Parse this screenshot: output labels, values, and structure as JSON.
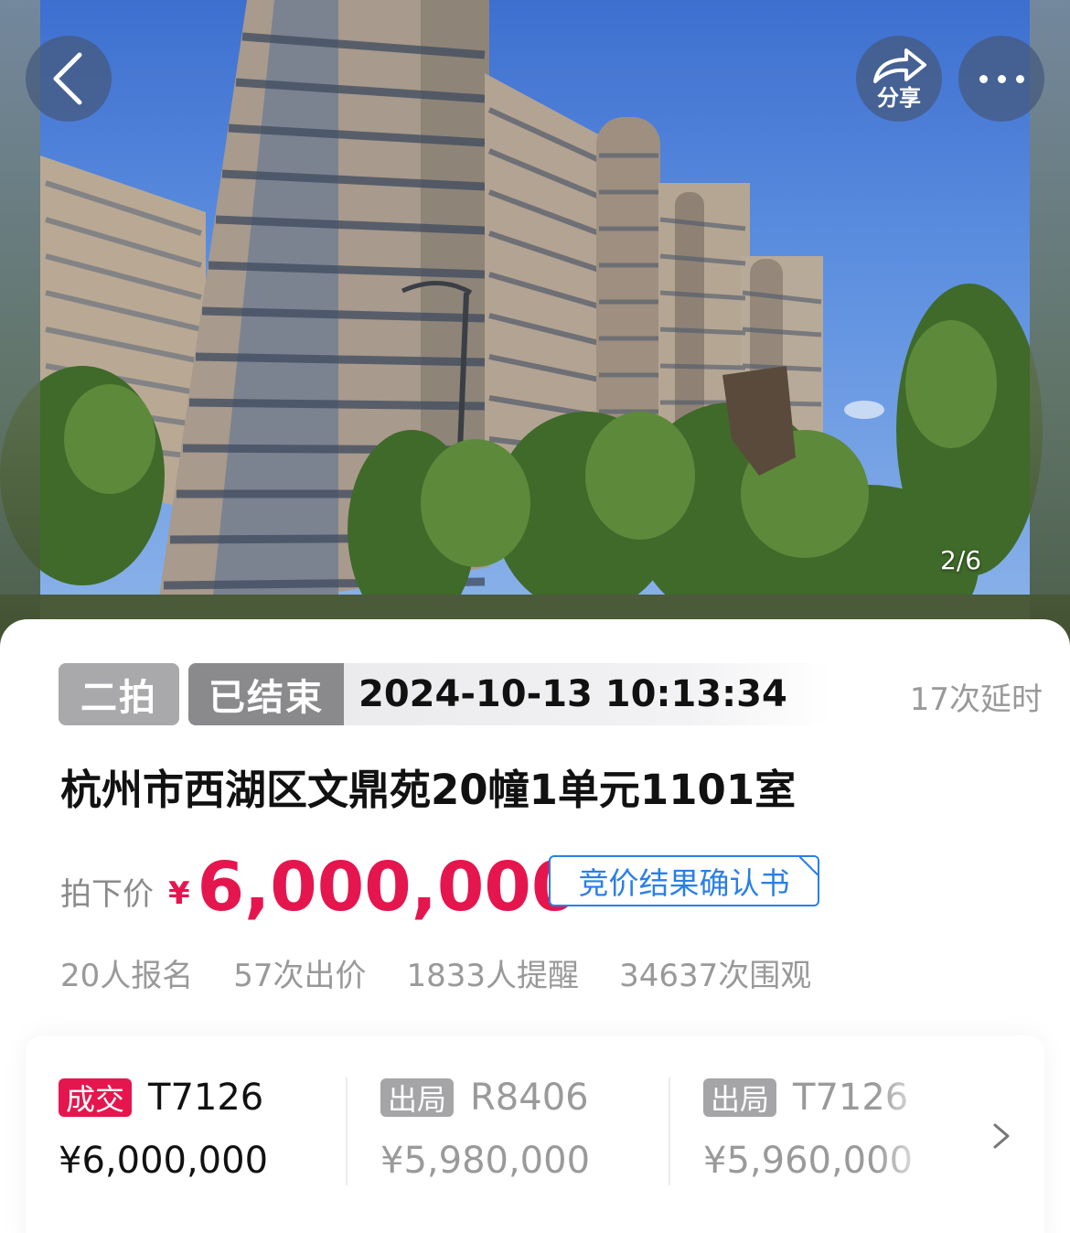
{
  "photo": {
    "page_indicator": "2/6"
  },
  "nav": {
    "share_label": "分享"
  },
  "auction": {
    "round_tag": "二拍",
    "status_tag": "已结束",
    "end_time": "2024-10-13 10:13:34",
    "delay_text": "17次延时",
    "title": "杭州市西湖区文鼎苑20幢1单元1101室",
    "price_label": "拍下价",
    "currency": "¥",
    "price": "6,000,000",
    "confirm_button": "竞价结果确认书",
    "accent_color": "#e5164d",
    "link_color": "#2a7fe6"
  },
  "stats": [
    {
      "label": "20人报名"
    },
    {
      "label": "57次出价"
    },
    {
      "label": "1833人提醒"
    },
    {
      "label": "34637次围观"
    }
  ],
  "bids": [
    {
      "tag": "成交",
      "bidder": "T7126",
      "amount": "¥6,000,000"
    },
    {
      "tag": "出局",
      "bidder": "R8406",
      "amount": "¥5,980,000"
    },
    {
      "tag": "出局",
      "bidder": "T7126",
      "amount": "¥5,960,000"
    }
  ]
}
